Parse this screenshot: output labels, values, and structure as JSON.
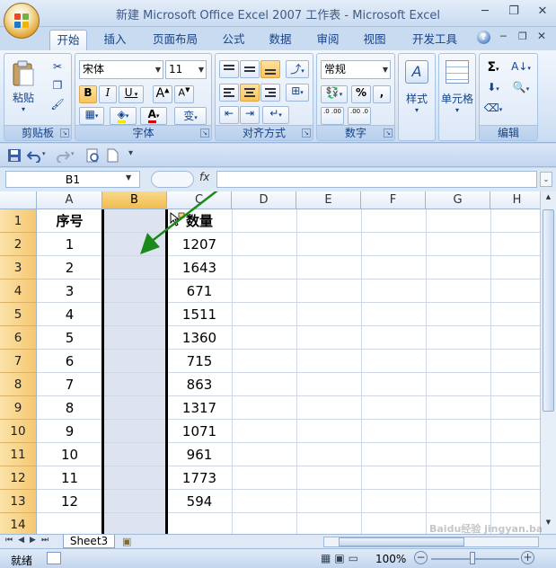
{
  "window": {
    "title": "新建 Microsoft Office Excel 2007 工作表 - Microsoft Excel"
  },
  "ribbon_tabs": [
    "开始",
    "插入",
    "页面布局",
    "公式",
    "数据",
    "审阅",
    "视图",
    "开发工具"
  ],
  "ribbon": {
    "clipboard": {
      "paste_label": "粘贴",
      "group_label": "剪贴板"
    },
    "font": {
      "font_name": "宋体",
      "font_size": "11",
      "bold": "B",
      "italic": "I",
      "underline": "U",
      "grow": "A",
      "shrink": "A",
      "font_color_letter": "A",
      "wen": "变",
      "group_label": "字体"
    },
    "alignment": {
      "group_label": "对齐方式"
    },
    "number": {
      "format": "常规",
      "percent": "%",
      "comma": ",",
      "dec_more": ".0 .00",
      "dec_less": ".00 .0",
      "group_label": "数字"
    },
    "styles": {
      "label": "样式"
    },
    "cells": {
      "label": "单元格"
    },
    "editing": {
      "group_label": "编辑",
      "sigma": "Σ"
    }
  },
  "formula_bar": {
    "name_box": "B1",
    "fx": "fx",
    "formula": ""
  },
  "columns": [
    "A",
    "B",
    "C",
    "D",
    "E",
    "F",
    "G",
    "H"
  ],
  "selected_column": "B",
  "rows": [
    "1",
    "2",
    "3",
    "4",
    "5",
    "6",
    "7",
    "8",
    "9",
    "10",
    "11",
    "12",
    "13",
    "14"
  ],
  "table": {
    "headers": [
      "序号",
      "",
      "数量"
    ],
    "rows": [
      [
        "1",
        "",
        "1207"
      ],
      [
        "2",
        "",
        "1643"
      ],
      [
        "3",
        "",
        "671"
      ],
      [
        "4",
        "",
        "1511"
      ],
      [
        "5",
        "",
        "1360"
      ],
      [
        "6",
        "",
        "715"
      ],
      [
        "7",
        "",
        "863"
      ],
      [
        "8",
        "",
        "1317"
      ],
      [
        "9",
        "",
        "1071"
      ],
      [
        "10",
        "",
        "961"
      ],
      [
        "11",
        "",
        "1773"
      ],
      [
        "12",
        "",
        "594"
      ]
    ]
  },
  "sheet_tabs": {
    "active": "Sheet3"
  },
  "status": {
    "ready": "就绪",
    "zoom": "100%"
  },
  "watermark": "Baidu经验 jingyan.baidu.com",
  "annotation": {
    "arrow_color": "#1a8a1a"
  }
}
